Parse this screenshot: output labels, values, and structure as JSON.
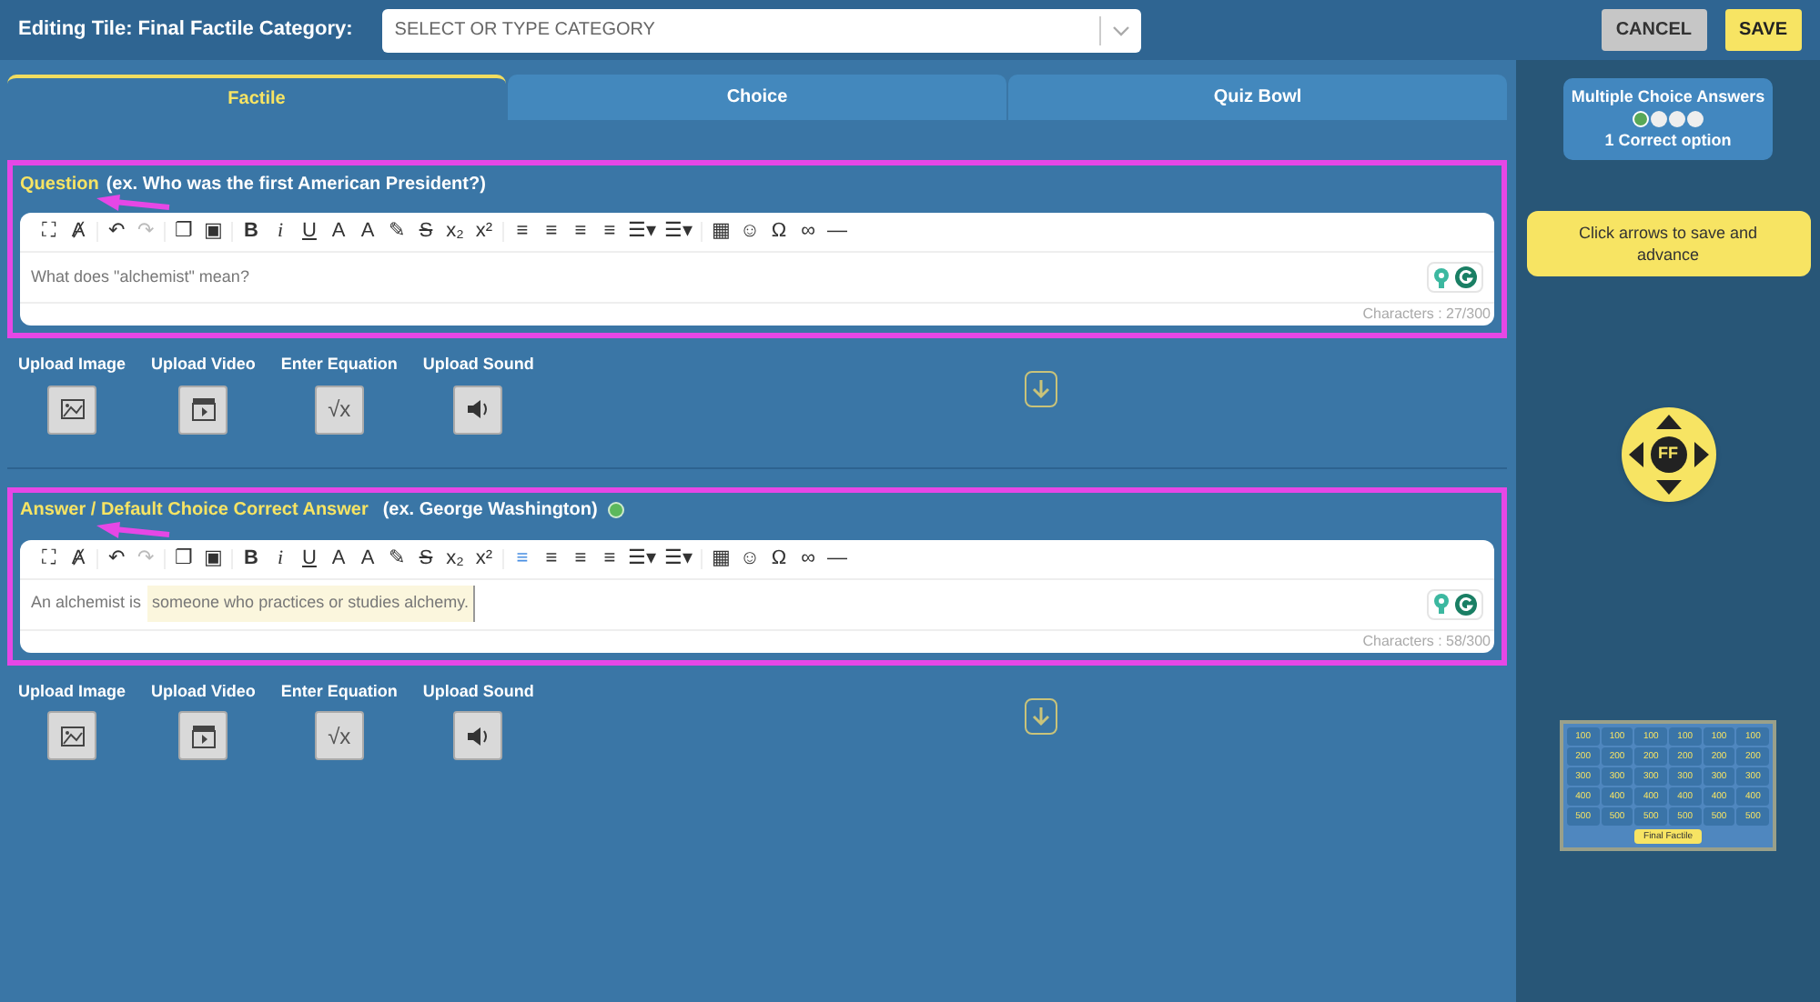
{
  "header": {
    "label": "Editing Tile: Final Factile Category:",
    "category_field": {
      "placeholder": "SELECT OR TYPE CATEGORY"
    },
    "buttons": [
      {
        "label": "CANCEL",
        "kind": "secondary"
      },
      {
        "label": "SAVE",
        "kind": "primary"
      }
    ]
  },
  "tabs": [
    {
      "label": "Factile",
      "selected": true
    },
    {
      "label": "Choice",
      "selected": false
    },
    {
      "label": "Quiz Bowl",
      "selected": false
    }
  ],
  "sections": [
    {
      "title": "Question",
      "hint": "(ex. Who was the first American President?)",
      "confirmed": false,
      "highlighted": true,
      "pointer_arrow": true,
      "toolbar": [
        [
          {
            "glyph": "⛶",
            "disabled": false,
            "selected": false
          },
          {
            "glyph": "Ⱥ",
            "disabled": false,
            "selected": false
          }
        ],
        [
          {
            "glyph": "↶",
            "disabled": false,
            "selected": false
          },
          {
            "glyph": "↷",
            "disabled": true,
            "selected": false
          }
        ],
        [
          {
            "glyph": "❐",
            "disabled": false,
            "selected": false
          },
          {
            "glyph": "▣",
            "disabled": false,
            "selected": false
          }
        ],
        [
          {
            "glyph": "B",
            "disabled": false,
            "selected": false
          },
          {
            "glyph": "i",
            "disabled": false,
            "selected": false
          },
          {
            "glyph": "U",
            "disabled": false,
            "selected": false
          },
          {
            "glyph": "A",
            "disabled": false,
            "selected": false
          },
          {
            "glyph": "A",
            "disabled": false,
            "selected": false
          },
          {
            "glyph": "✎",
            "disabled": false,
            "selected": false
          },
          {
            "glyph": "S",
            "disabled": false,
            "selected": false
          },
          {
            "glyph": "x₂",
            "disabled": false,
            "selected": false
          },
          {
            "glyph": "x²",
            "disabled": false,
            "selected": false
          }
        ],
        [
          {
            "glyph": "≡",
            "disabled": false,
            "selected": false
          },
          {
            "glyph": "≡",
            "disabled": false,
            "selected": false
          },
          {
            "glyph": "≡",
            "disabled": false,
            "selected": false
          },
          {
            "glyph": "≡",
            "disabled": false,
            "selected": false
          },
          {
            "glyph": "☰▾",
            "disabled": false,
            "selected": false
          },
          {
            "glyph": "☰▾",
            "disabled": false,
            "selected": false
          }
        ],
        [
          {
            "glyph": "▦",
            "disabled": false,
            "selected": false
          },
          {
            "glyph": "☺",
            "disabled": false,
            "selected": false
          },
          {
            "glyph": "Ω",
            "disabled": false,
            "selected": false
          },
          {
            "glyph": "∞",
            "disabled": false,
            "selected": false
          },
          {
            "glyph": "—",
            "disabled": false,
            "selected": false
          }
        ]
      ],
      "content": [
        {
          "text": "What does \"alchemist\" mean?",
          "highlighted": false
        }
      ],
      "counter": "Characters : 27/300",
      "media": [
        {
          "label": "Upload Image",
          "kind": "image"
        },
        {
          "label": "Upload Video",
          "kind": "video"
        },
        {
          "label": "Enter Equation",
          "kind": "equation",
          "glyph": "√x"
        },
        {
          "label": "Upload Sound",
          "kind": "sound"
        }
      ]
    },
    {
      "title": "Answer / Default Choice Correct Answer",
      "hint": "(ex. George Washington)",
      "confirmed": true,
      "highlighted": true,
      "pointer_arrow": true,
      "toolbar": [
        [
          {
            "glyph": "⛶",
            "disabled": false,
            "selected": false
          },
          {
            "glyph": "Ⱥ",
            "disabled": false,
            "selected": false
          }
        ],
        [
          {
            "glyph": "↶",
            "disabled": false,
            "selected": false
          },
          {
            "glyph": "↷",
            "disabled": true,
            "selected": false
          }
        ],
        [
          {
            "glyph": "❐",
            "disabled": false,
            "selected": false
          },
          {
            "glyph": "▣",
            "disabled": false,
            "selected": false
          }
        ],
        [
          {
            "glyph": "B",
            "disabled": false,
            "selected": false
          },
          {
            "glyph": "i",
            "disabled": false,
            "selected": false
          },
          {
            "glyph": "U",
            "disabled": false,
            "selected": false
          },
          {
            "glyph": "A",
            "disabled": false,
            "selected": false
          },
          {
            "glyph": "A",
            "disabled": false,
            "selected": false
          },
          {
            "glyph": "✎",
            "disabled": false,
            "selected": false
          },
          {
            "glyph": "S",
            "disabled": false,
            "selected": false
          },
          {
            "glyph": "x₂",
            "disabled": false,
            "selected": false
          },
          {
            "glyph": "x²",
            "disabled": false,
            "selected": false
          }
        ],
        [
          {
            "glyph": "≡",
            "disabled": false,
            "selected": true
          },
          {
            "glyph": "≡",
            "disabled": false,
            "selected": false
          },
          {
            "glyph": "≡",
            "disabled": false,
            "selected": false
          },
          {
            "glyph": "≡",
            "disabled": false,
            "selected": false
          },
          {
            "glyph": "☰▾",
            "disabled": false,
            "selected": false
          },
          {
            "glyph": "☰▾",
            "disabled": false,
            "selected": false
          }
        ],
        [
          {
            "glyph": "▦",
            "disabled": false,
            "selected": false
          },
          {
            "glyph": "☺",
            "disabled": false,
            "selected": false
          },
          {
            "glyph": "Ω",
            "disabled": false,
            "selected": false
          },
          {
            "glyph": "∞",
            "disabled": false,
            "selected": false
          },
          {
            "glyph": "—",
            "disabled": false,
            "selected": false
          }
        ]
      ],
      "content": [
        {
          "text": "An alchemist is",
          "highlighted": false
        },
        {
          "text": "someone who practices or studies alchemy.",
          "highlighted": true
        }
      ],
      "counter": "Characters : 58/300",
      "media": [
        {
          "label": "Upload Image",
          "kind": "image"
        },
        {
          "label": "Upload Video",
          "kind": "video"
        },
        {
          "label": "Enter Equation",
          "kind": "equation",
          "glyph": "√x"
        },
        {
          "label": "Upload Sound",
          "kind": "sound"
        }
      ]
    }
  ],
  "sidebar": {
    "answers_card": {
      "title": "Multiple Choice Answers",
      "options": [
        {
          "correct": true
        },
        {
          "correct": false
        },
        {
          "correct": false
        },
        {
          "correct": false
        }
      ],
      "caption": "1 Correct option"
    },
    "hint": "Click arrows to save and advance",
    "dpad_label": "FF",
    "board": {
      "rows": [
        [
          "100",
          "100",
          "100",
          "100",
          "100",
          "100"
        ],
        [
          "200",
          "200",
          "200",
          "200",
          "200",
          "200"
        ],
        [
          "300",
          "300",
          "300",
          "300",
          "300",
          "300"
        ],
        [
          "400",
          "400",
          "400",
          "400",
          "400",
          "400"
        ],
        [
          "500",
          "500",
          "500",
          "500",
          "500",
          "500"
        ]
      ],
      "final": "Final Factile"
    }
  }
}
